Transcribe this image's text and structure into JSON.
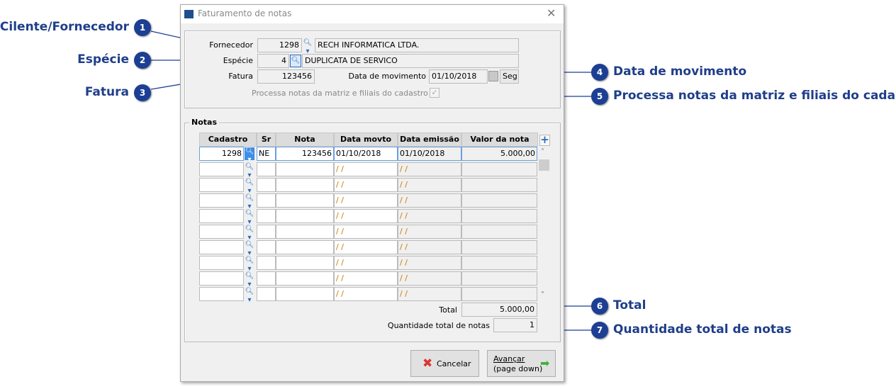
{
  "window": {
    "title": "Faturamento de notas",
    "close": "✕"
  },
  "form": {
    "fornecedor": {
      "label": "Fornecedor",
      "code": "1298",
      "name": "RECH INFORMATICA LTDA."
    },
    "especie": {
      "label": "Espécie",
      "code": "4",
      "name": "DUPLICATA DE SERVICO"
    },
    "fatura": {
      "label": "Fatura",
      "value": "123456"
    },
    "data_movimento": {
      "label": "Data de movimento",
      "value": "01/10/2018",
      "weekday": "Seg"
    },
    "processa": {
      "label": "Processa notas da matriz e filiais do cadastro",
      "checked": true
    }
  },
  "notas": {
    "group_label": "Notas",
    "columns": [
      "Cadastro",
      "Sr",
      "Nota",
      "Data movto",
      "Data emissão",
      "Valor da nota"
    ],
    "rows": [
      {
        "cadastro": "1298",
        "sr": "NE",
        "nota": "123456",
        "data_movto": "01/10/2018",
        "data_emissao": "01/10/2018",
        "valor": "5.000,00"
      },
      {
        "data_movto": "/ /",
        "data_emissao": "/ /"
      },
      {
        "data_movto": "/ /",
        "data_emissao": "/ /"
      },
      {
        "data_movto": "/ /",
        "data_emissao": "/ /"
      },
      {
        "data_movto": "/ /",
        "data_emissao": "/ /"
      },
      {
        "data_movto": "/ /",
        "data_emissao": "/ /"
      },
      {
        "data_movto": "/ /",
        "data_emissao": "/ /"
      },
      {
        "data_movto": "/ /",
        "data_emissao": "/ /"
      },
      {
        "data_movto": "/ /",
        "data_emissao": "/ /"
      },
      {
        "data_movto": "/ /",
        "data_emissao": "/ /"
      }
    ],
    "total_label": "Total",
    "total": "5.000,00",
    "qtd_label": "Quantidade total de notas",
    "qtd": "1"
  },
  "buttons": {
    "cancel": "Cancelar",
    "next_line1": "Avançar",
    "next_line2": "(page down)"
  },
  "callouts": [
    {
      "n": "1",
      "text": "Cilente/Fornecedor"
    },
    {
      "n": "2",
      "text": "Espécie"
    },
    {
      "n": "3",
      "text": "Fatura"
    },
    {
      "n": "4",
      "text": "Data de movimento"
    },
    {
      "n": "5",
      "text": "Processa notas da matriz e filiais do cadastro"
    },
    {
      "n": "6",
      "text": "Total"
    },
    {
      "n": "7",
      "text": "Quantidade total de notas"
    }
  ],
  "colors": {
    "callout": "#1c3f94",
    "accent": "#2a6bbf"
  }
}
